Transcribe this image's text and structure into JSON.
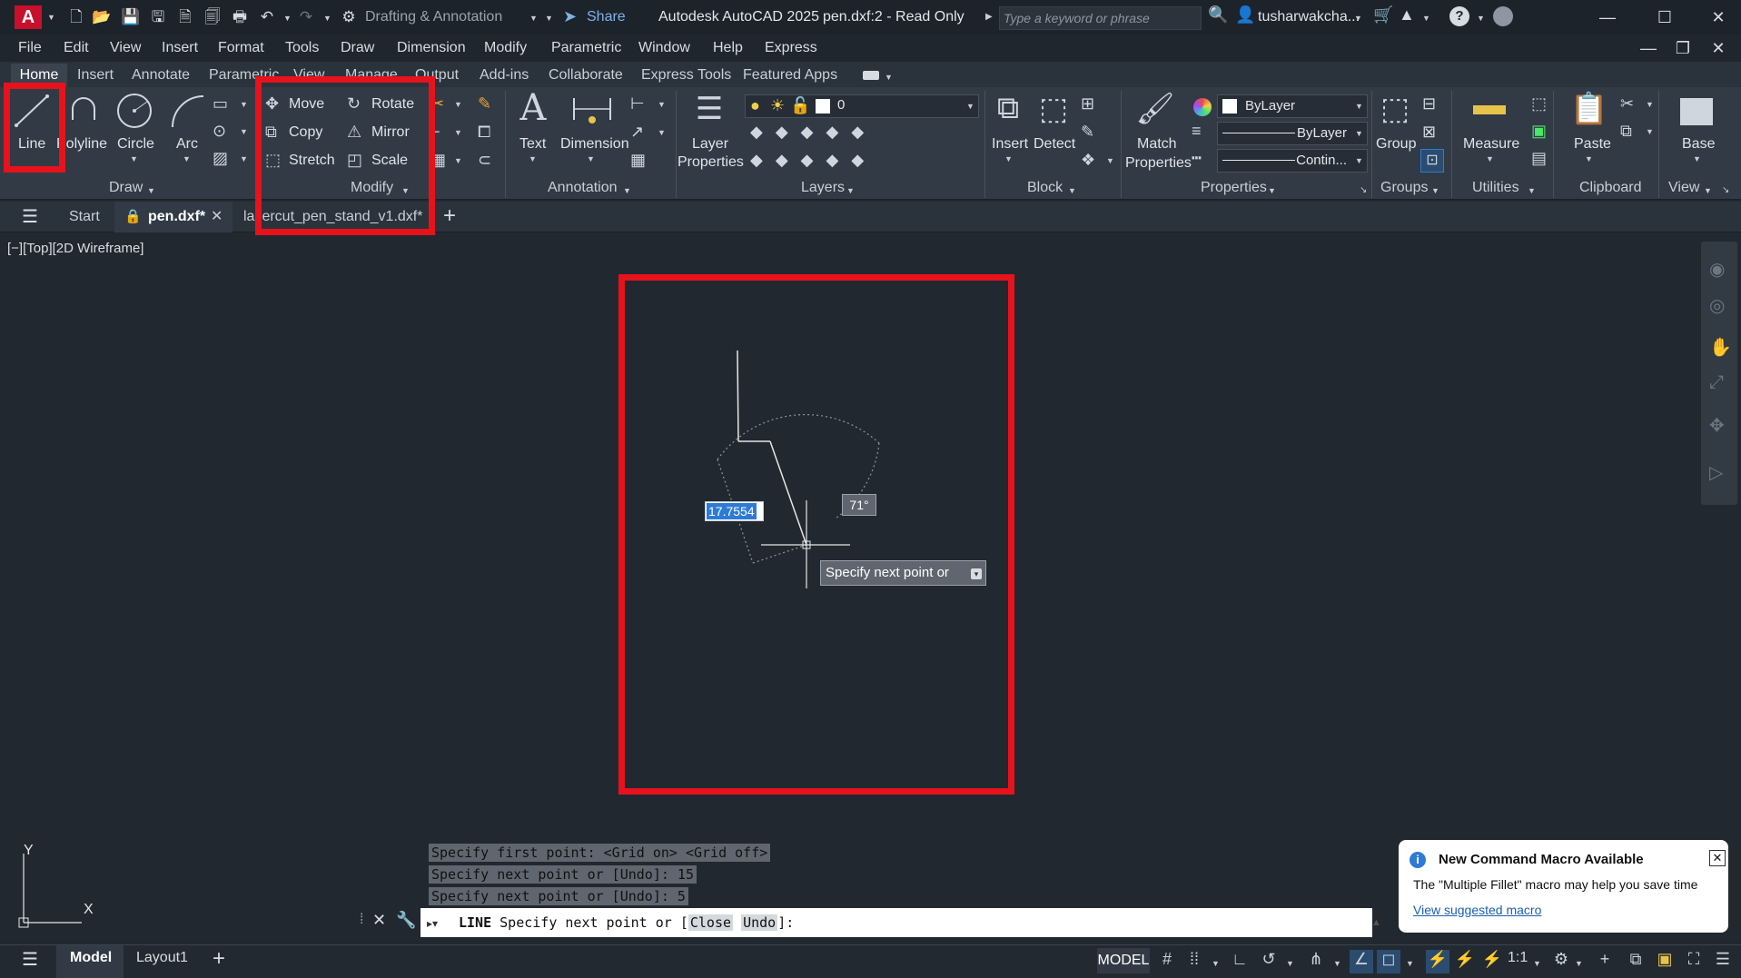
{
  "titlebar": {
    "app_letter": "A",
    "workspace": "Drafting & Annotation",
    "share": "Share",
    "app_title": "Autodesk AutoCAD 2025",
    "file_title": "pen.dxf:2 - Read Only",
    "search_placeholder": "Type a keyword or phrase",
    "user": "tusharwakcha...",
    "help": "?"
  },
  "menubar": [
    "File",
    "Edit",
    "View",
    "Insert",
    "Format",
    "Tools",
    "Draw",
    "Dimension",
    "Modify",
    "Parametric",
    "Window",
    "Help",
    "Express"
  ],
  "ribbon_tabs": [
    "Home",
    "Insert",
    "Annotate",
    "Parametric",
    "View",
    "Manage",
    "Output",
    "Add-ins",
    "Collaborate",
    "Express Tools",
    "Featured Apps"
  ],
  "ribbon": {
    "draw": {
      "label": "Draw",
      "line": "Line",
      "polyline": "Polyline",
      "circle": "Circle",
      "arc": "Arc"
    },
    "modify": {
      "label": "Modify",
      "move": "Move",
      "rotate": "Rotate",
      "copy": "Copy",
      "mirror": "Mirror",
      "stretch": "Stretch",
      "scale": "Scale"
    },
    "annotation": {
      "label": "Annotation",
      "text": "Text",
      "dimension": "Dimension"
    },
    "layers": {
      "label": "Layers",
      "layer_properties_1": "Layer",
      "layer_properties_2": "Properties",
      "current_layer": "0"
    },
    "block": {
      "label": "Block",
      "insert": "Insert",
      "detect": "Detect"
    },
    "properties": {
      "label": "Properties",
      "match_1": "Match",
      "match_2": "Properties",
      "color": "ByLayer",
      "lineweight": "ByLayer",
      "linetype": "Contin..."
    },
    "groups": {
      "label": "Groups",
      "group": "Group"
    },
    "utilities": {
      "label": "Utilities",
      "measure": "Measure"
    },
    "clipboard": {
      "label": "Clipboard",
      "paste": "Paste"
    },
    "view": {
      "label": "View",
      "base": "Base"
    }
  },
  "file_tabs": {
    "start": "Start",
    "tab1": "pen.dxf*",
    "tab2": "lasercut_pen_stand_v1.dxf*"
  },
  "viewport": {
    "label": "[−][Top][2D Wireframe]",
    "length_input": "17.7554",
    "angle": "71°",
    "tooltip": "Specify next point or",
    "ucs_y": "Y",
    "ucs_x": "X"
  },
  "command": {
    "history": [
      "Specify first point:  <Grid on>  <Grid off>",
      "Specify next point or [Undo]: 15",
      "Specify next point or [Undo]: 5"
    ],
    "prompt_cmd": "LINE",
    "prompt_text": "Specify next point or [",
    "opt_close": "Close",
    "opt_undo": "Undo",
    "prompt_end": "]:"
  },
  "statusbar": {
    "model_tab": "Model",
    "layout1": "Layout1",
    "model_toggle": "MODEL",
    "scale": "1:1"
  },
  "notification": {
    "title": "New Command Macro Available",
    "body": "The \"Multiple Fillet\" macro may help you save time",
    "link": "View suggested macro"
  },
  "colors": {
    "highlight": "#e8121c",
    "accent": "#2d7bd6",
    "background": "#212830"
  }
}
